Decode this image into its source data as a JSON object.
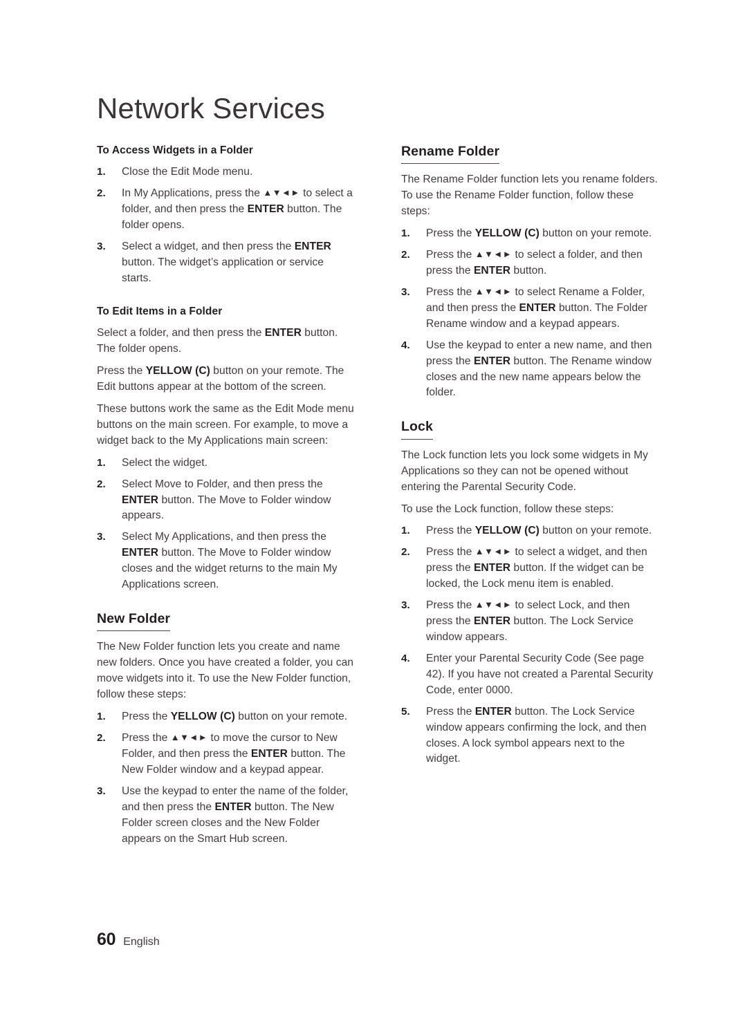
{
  "document": {
    "chapter_title": "Network Services",
    "page_number": "60",
    "language": "English"
  },
  "left_column": {
    "section_access": {
      "heading": "To Access Widgets in a Folder",
      "steps": [
        {
          "num": "1.",
          "text": "Close the Edit Mode menu."
        },
        {
          "num": "2.",
          "parts": [
            {
              "t": "In My Applications, press the "
            },
            {
              "t": "▲▼◄►",
              "style": "arrows"
            },
            {
              "t": " to select a folder, and then press the "
            },
            {
              "t": "ENTER",
              "style": "bold"
            },
            {
              "t": " button. The folder opens."
            }
          ]
        },
        {
          "num": "3.",
          "parts": [
            {
              "t": "Select a widget, and then press the "
            },
            {
              "t": "ENTER",
              "style": "bold"
            },
            {
              "t": " button. The widget’s application or service starts."
            }
          ]
        }
      ]
    },
    "section_edit": {
      "heading": "To Edit Items in a Folder",
      "paragraphs": [
        [
          {
            "t": "Select a folder, and then press the "
          },
          {
            "t": "ENTER",
            "style": "bold"
          },
          {
            "t": " button. The folder opens."
          }
        ],
        [
          {
            "t": "Press the "
          },
          {
            "t": "YELLOW (C)",
            "style": "bold"
          },
          {
            "t": " button on your remote. The Edit buttons appear at the bottom of the screen."
          }
        ],
        [
          {
            "t": "These buttons work the same as the Edit Mode menu buttons on the main screen. For example, to move a widget back to the My Applications main screen:"
          }
        ]
      ],
      "steps": [
        {
          "num": "1.",
          "text": "Select the widget."
        },
        {
          "num": "2.",
          "parts": [
            {
              "t": "Select Move to Folder, and then press the "
            },
            {
              "t": "ENTER",
              "style": "bold"
            },
            {
              "t": " button. The Move to Folder window appears."
            }
          ]
        },
        {
          "num": "3.",
          "parts": [
            {
              "t": "Select My Applications, and then press the "
            },
            {
              "t": "ENTER",
              "style": "bold"
            },
            {
              "t": " button. The Move to Folder window closes and the widget returns to the main My Applications screen."
            }
          ]
        }
      ]
    },
    "section_new_folder": {
      "heading": "New Folder",
      "paragraphs": [
        [
          {
            "t": "The New Folder function lets you create and name new folders. Once you have created a folder, you can move widgets into it. To use the New Folder function, follow these steps:"
          }
        ]
      ],
      "steps": [
        {
          "num": "1.",
          "parts": [
            {
              "t": "Press the "
            },
            {
              "t": "YELLOW (C)",
              "style": "bold"
            },
            {
              "t": " button on your remote."
            }
          ]
        },
        {
          "num": "2.",
          "parts": [
            {
              "t": "Press the "
            },
            {
              "t": "▲▼◄►",
              "style": "arrows"
            },
            {
              "t": " to move the cursor to New Folder, and then press the "
            },
            {
              "t": "ENTER",
              "style": "bold"
            },
            {
              "t": " button. The New Folder window and a keypad appear."
            }
          ]
        },
        {
          "num": "3.",
          "parts": [
            {
              "t": "Use the keypad to enter the name of the folder, and then press the "
            },
            {
              "t": "ENTER",
              "style": "bold"
            },
            {
              "t": " button. The New Folder screen closes and the New Folder appears on the Smart Hub screen."
            }
          ]
        }
      ]
    }
  },
  "right_column": {
    "section_rename": {
      "heading": "Rename Folder",
      "paragraphs": [
        [
          {
            "t": "The Rename Folder function lets you rename folders. To use the Rename Folder function, follow these steps:"
          }
        ]
      ],
      "steps": [
        {
          "num": "1.",
          "parts": [
            {
              "t": "Press the "
            },
            {
              "t": "YELLOW (C)",
              "style": "bold"
            },
            {
              "t": " button on your remote."
            }
          ]
        },
        {
          "num": "2.",
          "parts": [
            {
              "t": "Press the "
            },
            {
              "t": "▲▼◄►",
              "style": "arrows"
            },
            {
              "t": " to select a folder, and then press the "
            },
            {
              "t": "ENTER",
              "style": "bold"
            },
            {
              "t": " button."
            }
          ]
        },
        {
          "num": "3.",
          "parts": [
            {
              "t": "Press the "
            },
            {
              "t": "▲▼◄►",
              "style": "arrows"
            },
            {
              "t": " to select Rename a Folder, and then press the "
            },
            {
              "t": "ENTER",
              "style": "bold"
            },
            {
              "t": " button. The Folder Rename window and a keypad appears."
            }
          ]
        },
        {
          "num": "4.",
          "parts": [
            {
              "t": "Use the keypad to enter a new name, and then press the "
            },
            {
              "t": "ENTER",
              "style": "bold"
            },
            {
              "t": " button. The Rename window closes and the new name appears below the folder."
            }
          ]
        }
      ]
    },
    "section_lock": {
      "heading": "Lock",
      "paragraphs": [
        [
          {
            "t": "The Lock function lets you lock some widgets in My Applications so they can not be opened without entering the Parental Security Code."
          }
        ],
        [
          {
            "t": "To use the Lock function, follow these steps:"
          }
        ]
      ],
      "steps": [
        {
          "num": "1.",
          "parts": [
            {
              "t": "Press the "
            },
            {
              "t": "YELLOW (C)",
              "style": "bold"
            },
            {
              "t": " button on your remote."
            }
          ]
        },
        {
          "num": "2.",
          "parts": [
            {
              "t": "Press the "
            },
            {
              "t": "▲▼◄►",
              "style": "arrows"
            },
            {
              "t": " to select a widget, and then press the "
            },
            {
              "t": "ENTER",
              "style": "bold"
            },
            {
              "t": " button. If the widget can be locked, the Lock menu item is enabled."
            }
          ]
        },
        {
          "num": "3.",
          "parts": [
            {
              "t": "Press the "
            },
            {
              "t": "▲▼◄►",
              "style": "arrows"
            },
            {
              "t": " to select Lock, and then press the "
            },
            {
              "t": "ENTER",
              "style": "bold"
            },
            {
              "t": " button. The Lock Service window appears."
            }
          ]
        },
        {
          "num": "4.",
          "parts": [
            {
              "t": "Enter your Parental Security Code (See page 42). If you have not created a Parental Security Code, enter 0000."
            }
          ]
        },
        {
          "num": "5.",
          "parts": [
            {
              "t": "Press the "
            },
            {
              "t": "ENTER",
              "style": "bold"
            },
            {
              "t": " button. The Lock Service window appears confirming the lock, and then closes. A lock symbol appears next to the widget."
            }
          ]
        }
      ]
    }
  }
}
